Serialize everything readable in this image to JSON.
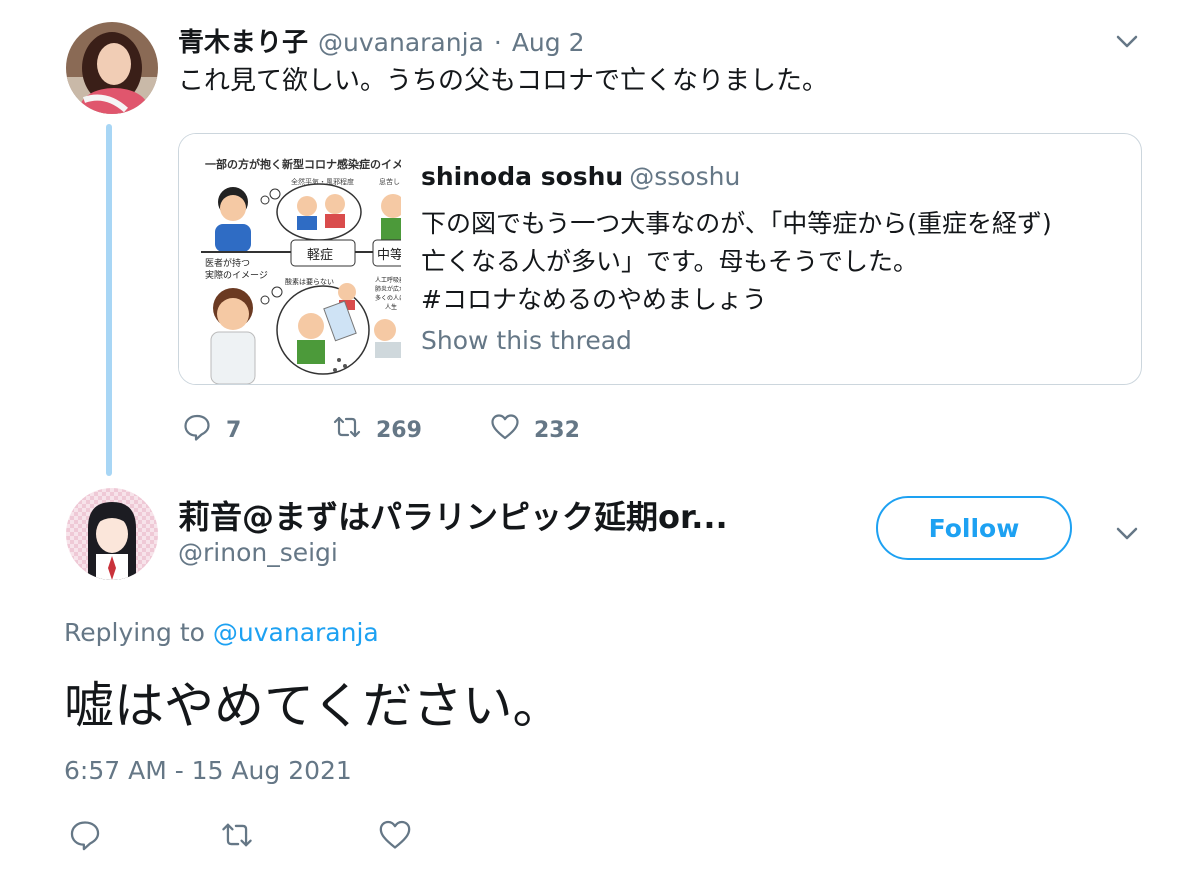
{
  "parent": {
    "name": "青木まり子",
    "handle": "@uvanaranja",
    "separator": "·",
    "date": "Aug 2",
    "text": "これ見て欲しい。うちの父もコロナで亡くなりました。",
    "quote": {
      "name": "shinoda soshu",
      "handle": "@ssoshu",
      "lines": [
        "下の図でもう一つ大事なのが、「中等症から(重症を経ず)",
        "亡くなる人が多い」です。母もそうでした。",
        "#コロナなめるのやめましょう"
      ],
      "show_thread": "Show this thread",
      "image": {
        "header": "一部の方が抱く新型コロナ感染症のイメ",
        "caption_top": "全然平気・風邪程度",
        "caption_right": "息苦し",
        "label_mild": "軽症",
        "label_moderate": "中等",
        "doctor_label_1": "医者が持つ",
        "doctor_label_2": "実際のイメージ",
        "bubble_text": "酸素は要らない",
        "side_text_1": "人工呼吸器が",
        "side_text_2": "肺炎が広が",
        "side_text_3": "多くの人に",
        "side_text_4": "人生"
      }
    },
    "stats": {
      "replies": "7",
      "retweets": "269",
      "likes": "232"
    }
  },
  "reply": {
    "name": "莉音@まずはパラリンピック延期or...",
    "handle": "@rinon_seigi",
    "follow_label": "Follow",
    "replying_prefix": "Replying to ",
    "replying_to": "@uvanaranja",
    "text": "嘘はやめてください。",
    "timestamp": "6:57 AM - 15 Aug 2021"
  },
  "icons": {
    "caret": "chevron-down-icon",
    "reply": "reply-icon",
    "retweet": "retweet-icon",
    "like": "heart-icon"
  },
  "colors": {
    "accent": "#1da1f2",
    "muted": "#657786",
    "thread_line": "#a8d6f5",
    "border": "#ccd6dd"
  }
}
